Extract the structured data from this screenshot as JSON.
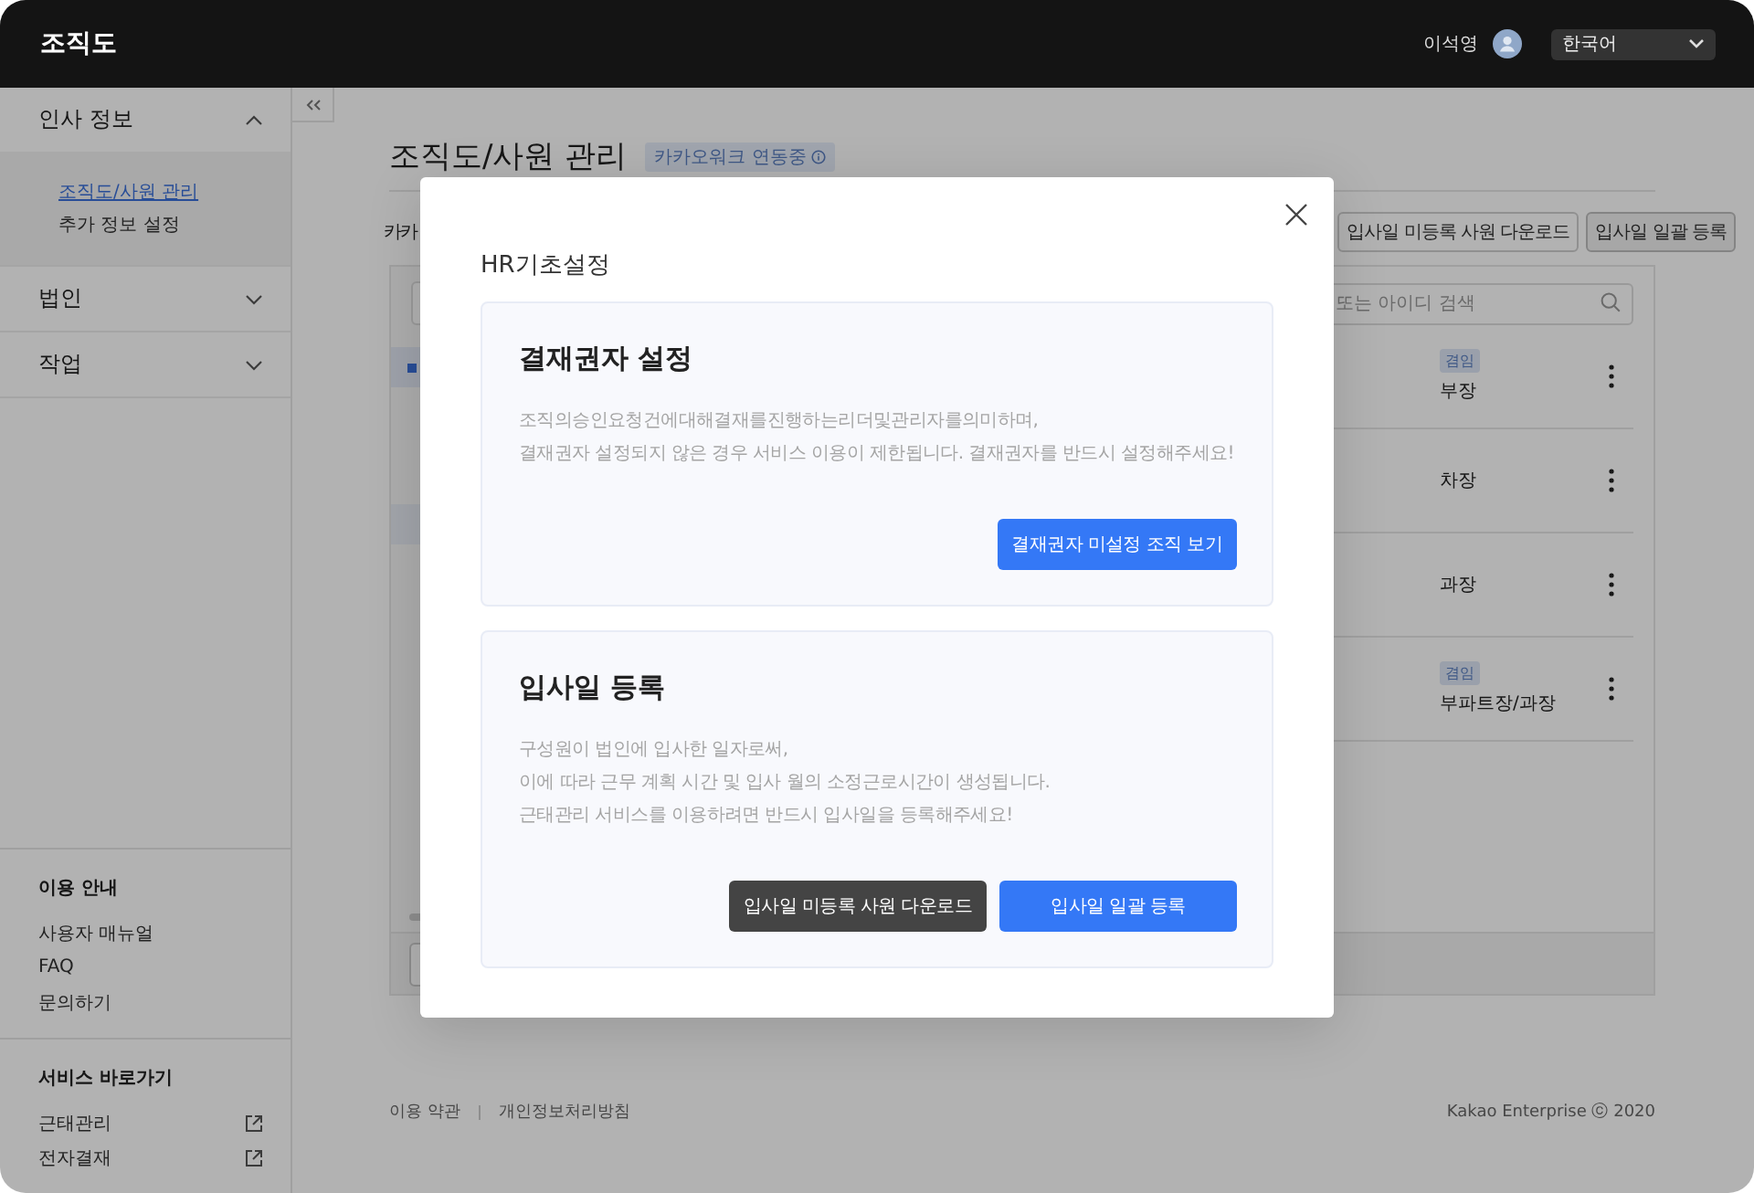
{
  "header": {
    "title": "조직도",
    "user_name": "이석영",
    "language": "한국어"
  },
  "sidebar": {
    "groups": [
      {
        "label": "인사 정보",
        "expanded": true,
        "children": [
          {
            "label": "조직도/사원 관리",
            "selected": true
          },
          {
            "label": "추가 정보 설정",
            "selected": false
          }
        ]
      },
      {
        "label": "법인",
        "expanded": false
      },
      {
        "label": "작업",
        "expanded": false
      }
    ],
    "sections": [
      {
        "title": "이용 안내",
        "links": [
          {
            "label": "사용자 매뉴얼",
            "kind": "internal"
          },
          {
            "label": "FAQ",
            "kind": "internal"
          },
          {
            "label": "문의하기",
            "kind": "internal"
          }
        ]
      },
      {
        "title": "서비스 바로가기",
        "links": [
          {
            "label": "근태관리",
            "kind": "external"
          },
          {
            "label": "전자결재",
            "kind": "external"
          }
        ]
      }
    ]
  },
  "page": {
    "title": "조직도/사원 관리",
    "badge": "카카오워크 연동중",
    "section_label": "카카",
    "buttons": [
      {
        "label": "입사일 미등록 사원 다운로드",
        "kind": "outline"
      },
      {
        "label": "입사일 일괄 등록",
        "kind": "filled"
      }
    ],
    "search": {
      "placeholder": "또는 아이디 검색"
    },
    "rows": [
      {
        "tag": "겸임",
        "position": "부장"
      },
      {
        "position": "차장"
      },
      {
        "position": "과장"
      },
      {
        "tag": "겸임",
        "position": "부파트장/과장"
      }
    ]
  },
  "footer": {
    "links": [
      "이용 약관",
      "개인정보처리방침"
    ],
    "copyright": "Kakao Enterprise  ⓒ 2020"
  },
  "modal": {
    "title": "HR기초설정",
    "cards": [
      {
        "title": "결재권자 설정",
        "lines": [
          "조직의승인요청건에대해결재를진행하는리더및관리자를의미하며,",
          "결재권자 설정되지 않은 경우 서비스 이용이 제한됩니다. 결재권자를 반드시 설정해주세요!"
        ],
        "buttons": [
          {
            "label": "결재권자 미설정 조직 보기",
            "kind": "primary"
          }
        ]
      },
      {
        "title": "입사일 등록",
        "lines": [
          "구성원이 법인에 입사한 일자로써,",
          "이에 따라 근무 계획 시간 및 입사 월의 소정근로시간이 생성됩니다.",
          "근태관리 서비스를 이용하려면 반드시 입사일을 등록해주세요!"
        ],
        "buttons": [
          {
            "label": "입사일 미등록 사원 다운로드",
            "kind": "dark"
          },
          {
            "label": "입사일 일괄 등록",
            "kind": "primary"
          }
        ]
      }
    ]
  }
}
